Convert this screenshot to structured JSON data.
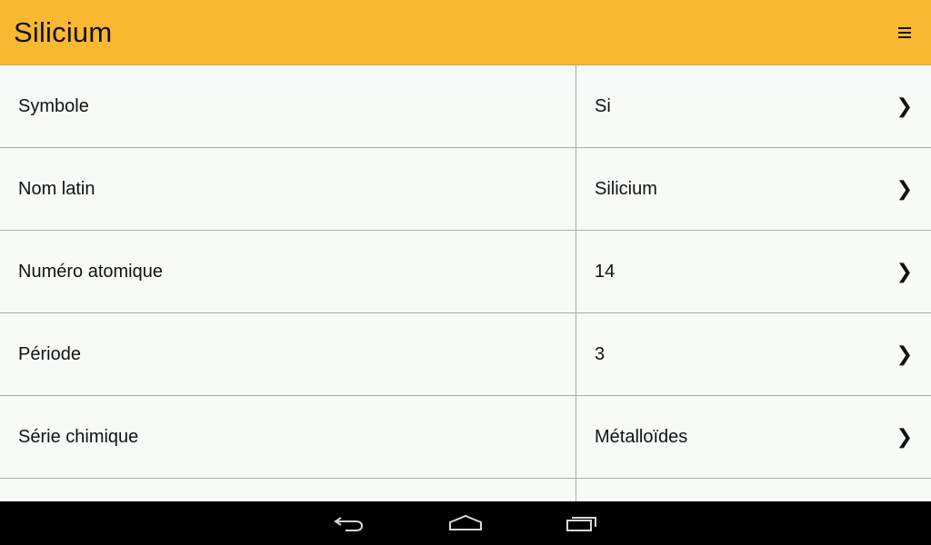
{
  "app": {
    "title": "Silicium",
    "menu_icon": "overflow-menu-icon"
  },
  "rows": [
    {
      "label": "Symbole",
      "value": "Si"
    },
    {
      "label": "Nom latin",
      "value": "Silicium"
    },
    {
      "label": "Numéro atomique",
      "value": "14"
    },
    {
      "label": "Période",
      "value": "3"
    },
    {
      "label": "Série chimique",
      "value": "Métalloïdes"
    },
    {
      "label": "",
      "value": ""
    }
  ],
  "row_chevron": "❯",
  "navigation": {
    "back_icon": "back-icon",
    "home_icon": "home-icon",
    "recents_icon": "recent-apps-icon"
  },
  "colors": {
    "appbar": "#f9b831",
    "background": "#f7fbf8",
    "divider": "#a9aaa9",
    "navbar": "#000000"
  }
}
